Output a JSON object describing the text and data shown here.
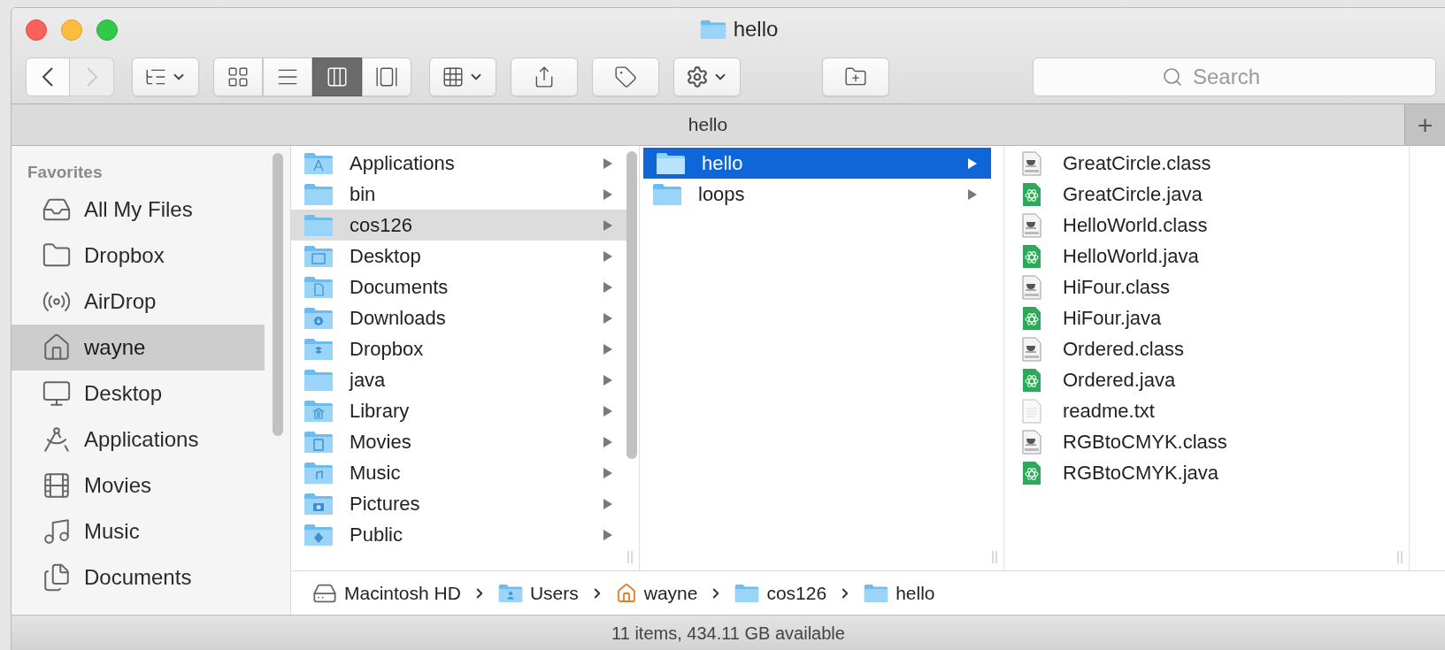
{
  "window": {
    "title": "hello"
  },
  "toolbar": {
    "nav": [
      {
        "kind": "back",
        "disabled": false
      },
      {
        "kind": "forward",
        "disabled": true
      }
    ],
    "view_modes": [
      {
        "kind": "icons",
        "selected": false
      },
      {
        "kind": "list",
        "selected": false
      },
      {
        "kind": "columns",
        "selected": true
      },
      {
        "kind": "gallery",
        "selected": false
      }
    ],
    "search": {
      "placeholder": "Search"
    }
  },
  "tab_bar": {
    "tabs": [
      {
        "label": "hello",
        "selected": true
      }
    ],
    "add": "+"
  },
  "sidebar": {
    "heading": "Favorites",
    "items": [
      {
        "label": "All My Files",
        "selected": false
      },
      {
        "label": "Dropbox",
        "selected": false
      },
      {
        "label": "AirDrop",
        "selected": false
      },
      {
        "label": "wayne",
        "selected": true
      },
      {
        "label": "Desktop",
        "selected": false
      },
      {
        "label": "Applications",
        "selected": false
      },
      {
        "label": "Movies",
        "selected": false
      },
      {
        "label": "Music",
        "selected": false
      },
      {
        "label": "Documents",
        "selected": false
      }
    ]
  },
  "columns": [
    {
      "items": [
        {
          "name": "Applications",
          "kind": "folder",
          "selected": false
        },
        {
          "name": "bin",
          "kind": "folder",
          "selected": false
        },
        {
          "name": "cos126",
          "kind": "folder",
          "selected": true
        },
        {
          "name": "Desktop",
          "kind": "folder",
          "selected": false
        },
        {
          "name": "Documents",
          "kind": "folder",
          "selected": false
        },
        {
          "name": "Downloads",
          "kind": "folder",
          "selected": false
        },
        {
          "name": "Dropbox",
          "kind": "folder",
          "selected": false
        },
        {
          "name": "java",
          "kind": "folder",
          "selected": false
        },
        {
          "name": "Library",
          "kind": "folder",
          "selected": false
        },
        {
          "name": "Movies",
          "kind": "folder",
          "selected": false
        },
        {
          "name": "Music",
          "kind": "folder",
          "selected": false
        },
        {
          "name": "Pictures",
          "kind": "folder",
          "selected": false
        },
        {
          "name": "Public",
          "kind": "folder",
          "selected": false
        }
      ]
    },
    {
      "items": [
        {
          "name": "hello",
          "kind": "folder",
          "selected": true
        },
        {
          "name": "loops",
          "kind": "folder",
          "selected": false
        }
      ]
    },
    {
      "items": [
        {
          "name": "GreatCircle.class",
          "kind": "class",
          "selected": false
        },
        {
          "name": "GreatCircle.java",
          "kind": "java",
          "selected": false
        },
        {
          "name": "HelloWorld.class",
          "kind": "class",
          "selected": false
        },
        {
          "name": "HelloWorld.java",
          "kind": "java",
          "selected": false
        },
        {
          "name": "HiFour.class",
          "kind": "class",
          "selected": false
        },
        {
          "name": "HiFour.java",
          "kind": "java",
          "selected": false
        },
        {
          "name": "Ordered.class",
          "kind": "class",
          "selected": false
        },
        {
          "name": "Ordered.java",
          "kind": "java",
          "selected": false
        },
        {
          "name": "readme.txt",
          "kind": "text",
          "selected": false
        },
        {
          "name": "RGBtoCMYK.class",
          "kind": "class",
          "selected": false
        },
        {
          "name": "RGBtoCMYK.java",
          "kind": "java",
          "selected": false
        }
      ]
    }
  ],
  "path_bar": [
    {
      "label": "Macintosh HD"
    },
    {
      "label": "Users"
    },
    {
      "label": "wayne"
    },
    {
      "label": "cos126"
    },
    {
      "label": "hello"
    }
  ],
  "status_bar": "11 items, 434.11 GB available"
}
